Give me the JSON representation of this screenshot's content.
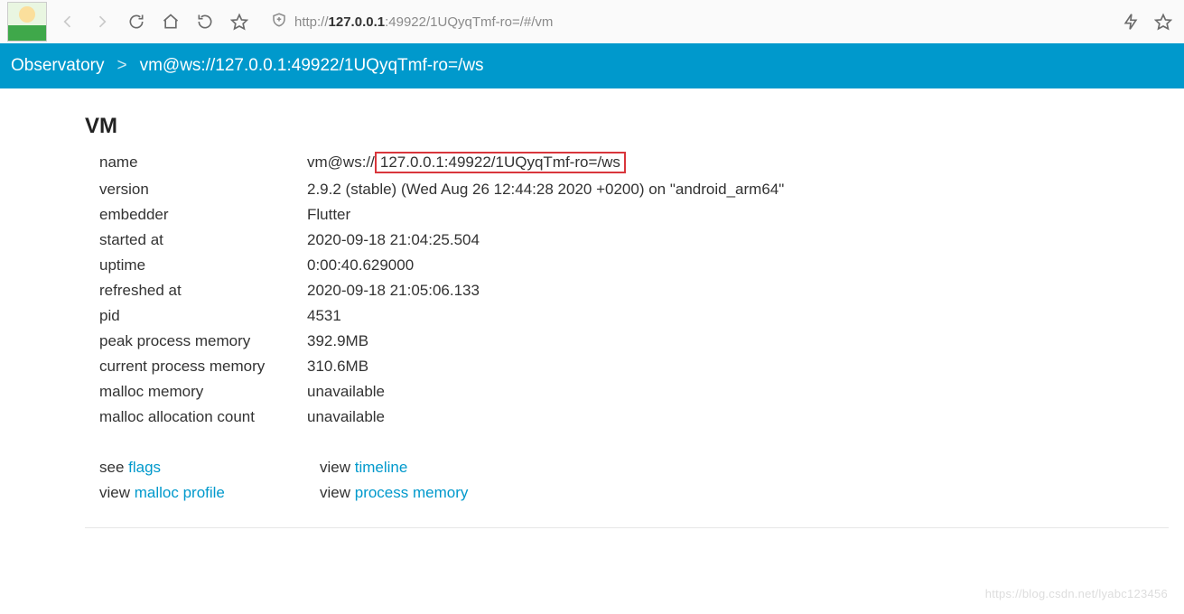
{
  "toolbar": {
    "url_prefix": "http://",
    "url_host": "127.0.0.1",
    "url_rest": ":49922/1UQyqTmf-ro=/#/vm"
  },
  "breadcrumb": {
    "root": "Observatory",
    "sep": ">",
    "current": "vm@ws://127.0.0.1:49922/1UQyqTmf-ro=/ws"
  },
  "section_title": "VM",
  "props": [
    {
      "k": "name",
      "v_prefix": "vm@ws://",
      "v_boxed": "127.0.0.1:49922/1UQyqTmf-ro=/ws"
    },
    {
      "k": "version",
      "v": "2.9.2 (stable) (Wed Aug 26 12:44:28 2020 +0200) on \"android_arm64\""
    },
    {
      "k": "embedder",
      "v": "Flutter"
    },
    {
      "k": "started at",
      "v": "2020-09-18 21:04:25.504"
    },
    {
      "k": "uptime",
      "v": "0:00:40.629000"
    },
    {
      "k": "refreshed at",
      "v": "2020-09-18 21:05:06.133"
    },
    {
      "k": "pid",
      "v": "4531"
    },
    {
      "k": "peak process memory",
      "v": "392.9MB"
    },
    {
      "k": "current process memory",
      "v": "310.6MB"
    },
    {
      "k": "malloc memory",
      "v": "unavailable"
    },
    {
      "k": "malloc allocation count",
      "v": "unavailable"
    }
  ],
  "links": {
    "see": "see ",
    "flags": "flags",
    "view": "view ",
    "timeline": "timeline",
    "malloc_profile": "malloc profile",
    "process_memory": "process memory"
  },
  "watermark": "https://blog.csdn.net/lyabc123456"
}
